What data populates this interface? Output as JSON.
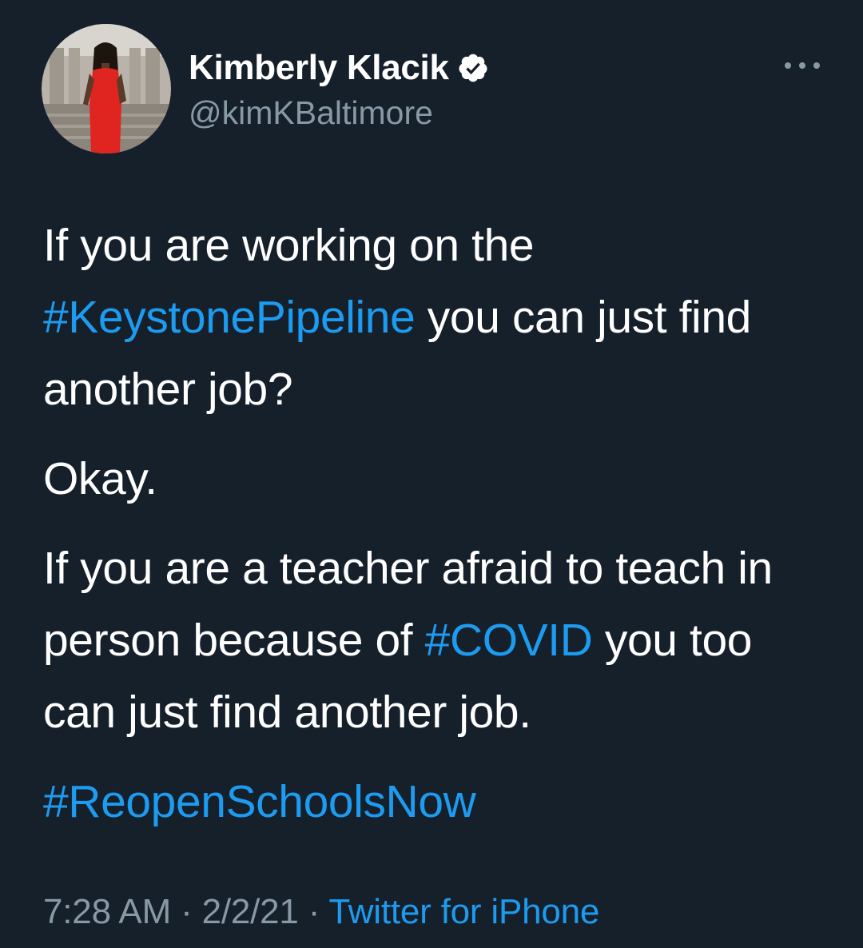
{
  "author": {
    "display_name": "Kimberly Klacik",
    "handle": "@kimKBaltimore",
    "verified": true,
    "avatar_icon": "profile-photo"
  },
  "tweet": {
    "para1": {
      "text_before": "If you are working on the ",
      "hashtag": "#KeystonePipeline",
      "text_after": " you can just find another job?"
    },
    "para2": "Okay.",
    "para3": {
      "text_before": "If you are a teacher afraid to teach in person because of ",
      "hashtag": "#COVID",
      "text_after": " you too can just find another job."
    },
    "para4": {
      "hashtag": "#ReopenSchoolsNow"
    }
  },
  "meta": {
    "time": "7:28 AM",
    "separator1": " · ",
    "date": "2/2/21",
    "separator2": " · ",
    "source": "Twitter for iPhone"
  },
  "colors": {
    "background": "#15202b",
    "text": "#ffffff",
    "secondary": "#8899a6",
    "link": "#1d9bf0"
  },
  "icons": {
    "more": "more-horizontal-icon",
    "verified": "verified-badge-icon"
  }
}
